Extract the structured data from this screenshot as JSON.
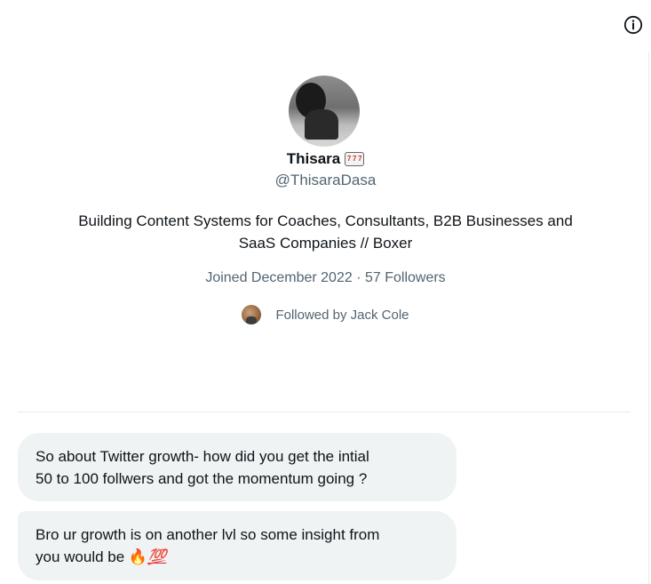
{
  "profile": {
    "name": "Thisara",
    "name_badge_icon": "slot-machine-icon",
    "handle": "@ThisaraDasa",
    "bio_line1": "Building Content Systems for Coaches, Consultants, B2B Businesses and",
    "bio_line2": "SaaS Companies // Boxer",
    "meta": "Joined December 2022 · 57 Followers",
    "followed_by": "Followed by Jack Cole"
  },
  "header": {
    "info_icon": "info-icon"
  },
  "messages": [
    {
      "line1": "So about Twitter growth- how did you get the intial",
      "line2": "50 to 100 follwers and got the momentum going ?"
    },
    {
      "line1": "Bro ur growth is on another lvl so some insight from",
      "line2": "you would be",
      "emoji_fire": "🔥",
      "emoji_hundred": "💯"
    }
  ]
}
